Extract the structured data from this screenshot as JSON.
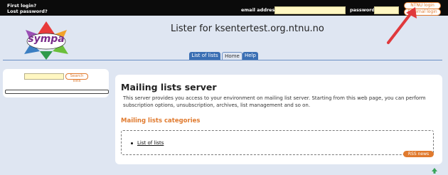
{
  "header": {
    "first_login": "First login?",
    "lost_password": "Lost password?",
    "email_label": "email address:",
    "password_label": "password:",
    "ntnu_login": "NTNU login",
    "external_login": "External login"
  },
  "brand": {
    "logo_text": "sympa",
    "site_title": "Lister for ksentertest.org.ntnu.no"
  },
  "tabs": [
    {
      "label": "List of lists"
    },
    {
      "label": "Home"
    },
    {
      "label": "Help"
    }
  ],
  "sidebar": {
    "search_button": "Search lists"
  },
  "main": {
    "title": "Mailing lists server",
    "intro": "This server provides you access to your environment on mailing list server. Starting from this web page, you can perform subscription options, unsubscription, archives, list management and so on.",
    "categories_title": "Mailing lists categories",
    "categories": [
      {
        "label": "List of lists"
      }
    ],
    "rss_button": "RSS news"
  },
  "colors": {
    "accent": "#e07a2e",
    "tab_blue": "#3a6fb4",
    "background": "#dfe6f2",
    "arrow": "#e0393c"
  }
}
